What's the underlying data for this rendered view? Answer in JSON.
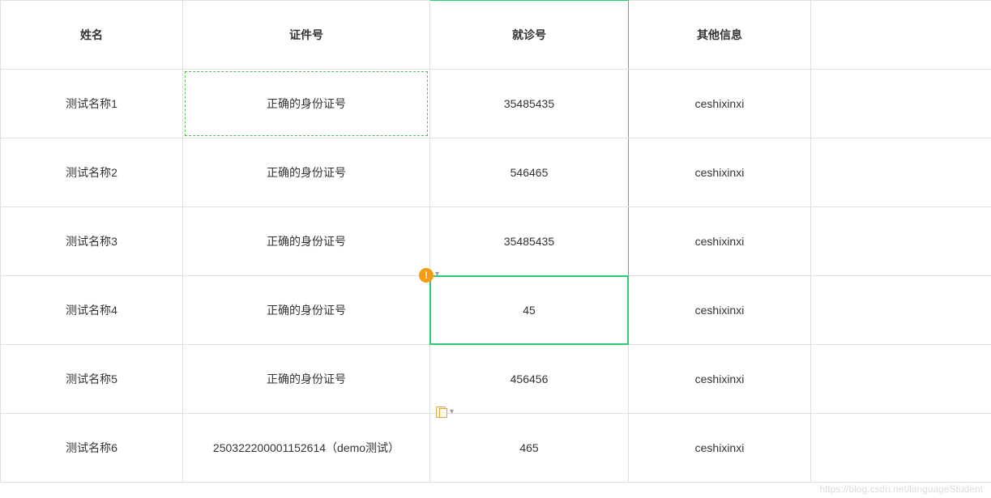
{
  "headers": {
    "name": "姓名",
    "id": "证件号",
    "visit": "就诊号",
    "other": "其他信息"
  },
  "rows": [
    {
      "name": "测试名称1",
      "id": "正确的身份证号",
      "visit": "35485435",
      "other": "ceshixinxi"
    },
    {
      "name": "测试名称2",
      "id": "正确的身份证号",
      "visit": "546465",
      "other": "ceshixinxi"
    },
    {
      "name": "测试名称3",
      "id": "正确的身份证号",
      "visit": "35485435",
      "other": "ceshixinxi"
    },
    {
      "name": "测试名称4",
      "id": "正确的身份证号",
      "visit": "45",
      "other": "ceshixinxi"
    },
    {
      "name": "测试名称5",
      "id": "正确的身份证号",
      "visit": "456456",
      "other": "ceshixinxi"
    },
    {
      "name": "测试名称6",
      "id": "250322200001152614（demo测试）",
      "visit": "465",
      "other": "ceshixinxi"
    }
  ],
  "watermark": "https://blog.csdn.net/languageStudent",
  "icons": {
    "warning": "!",
    "dropdown": "▾"
  }
}
